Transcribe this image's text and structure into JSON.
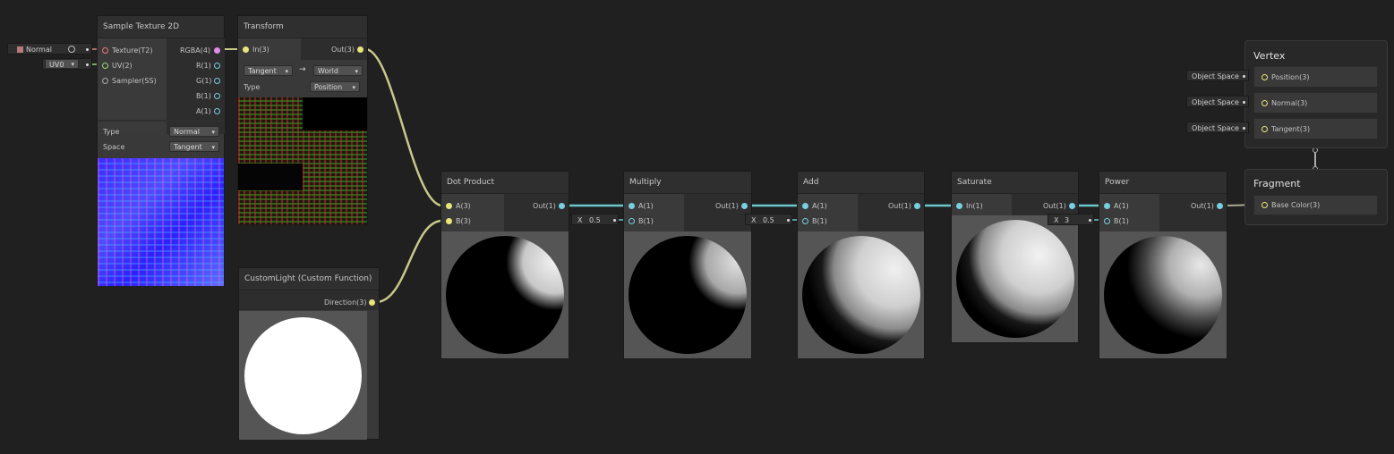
{
  "colors": {
    "background": "#202020",
    "node": "#393939",
    "vec3_wire": "#c7c98a",
    "vec1_wire": "#6cc8cc"
  },
  "inline_inputs": {
    "texture_value": "Normal",
    "uv_value": "UV0",
    "multiply_b": {
      "axis": "X",
      "value": "0.5"
    },
    "add_b": {
      "axis": "X",
      "value": "0.5"
    },
    "power_b": {
      "axis": "X",
      "value": "3"
    },
    "space_label": "Object Space"
  },
  "nodes": {
    "sample_texture": {
      "title": "Sample Texture 2D",
      "inputs": [
        "Texture(T2)",
        "UV(2)",
        "Sampler(SS)"
      ],
      "outputs": [
        "RGBA(4)",
        "R(1)",
        "G(1)",
        "B(1)",
        "A(1)"
      ],
      "type_label": "Type",
      "type_value": "Normal",
      "space_label": "Space",
      "space_value": "Tangent"
    },
    "transform": {
      "title": "Transform",
      "input": "In(3)",
      "output": "Out(3)",
      "from": "Tangent",
      "arrow": "→",
      "to": "World",
      "type_label": "Type",
      "type_value": "Position"
    },
    "custom_light": {
      "title": "CustomLight (Custom Function)",
      "output": "Direction(3)"
    },
    "dot_product": {
      "title": "Dot Product",
      "inputs": [
        "A(3)",
        "B(3)"
      ],
      "output": "Out(1)"
    },
    "multiply": {
      "title": "Multiply",
      "inputs": [
        "A(1)",
        "B(1)"
      ],
      "output": "Out(1)"
    },
    "add": {
      "title": "Add",
      "inputs": [
        "A(1)",
        "B(1)"
      ],
      "output": "Out(1)"
    },
    "saturate": {
      "title": "Saturate",
      "inputs": [
        "In(1)"
      ],
      "output": "Out(1)"
    },
    "power": {
      "title": "Power",
      "inputs": [
        "A(1)",
        "B(1)"
      ],
      "output": "Out(1)"
    }
  },
  "master": {
    "vertex": {
      "title": "Vertex",
      "slots": [
        "Position(3)",
        "Normal(3)",
        "Tangent(3)"
      ]
    },
    "fragment": {
      "title": "Fragment",
      "slots": [
        "Base Color(3)"
      ]
    }
  }
}
